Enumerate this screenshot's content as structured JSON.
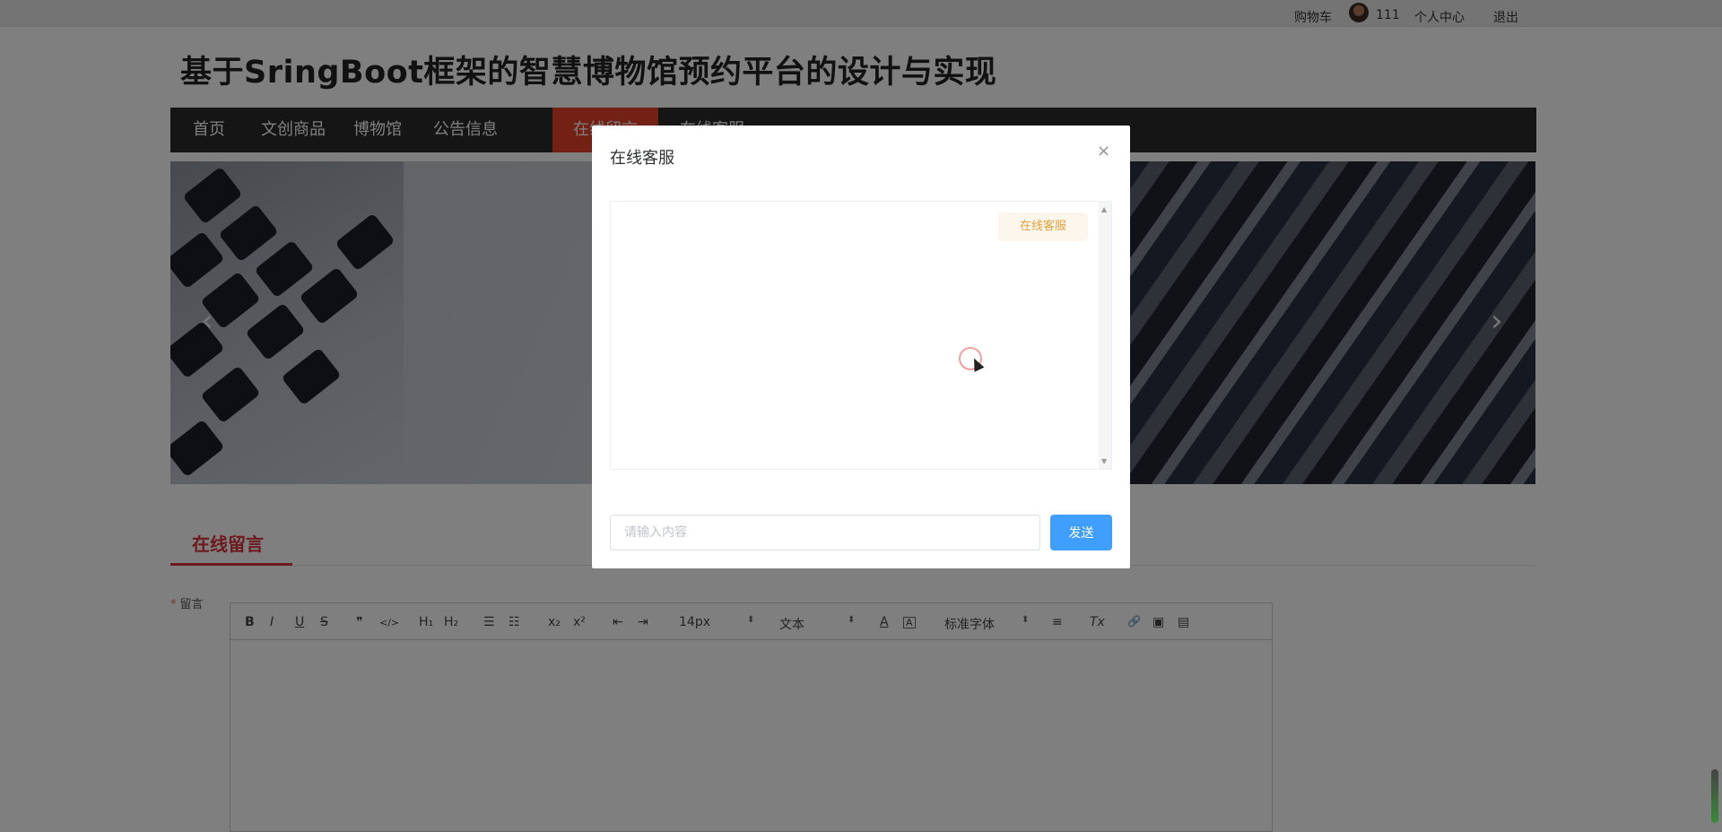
{
  "topbar": {
    "cart": "购物车",
    "username": "111",
    "profile": "个人中心",
    "logout": "退出"
  },
  "site": {
    "title": "基于SringBoot框架的智慧博物馆预约平台的设计与实现"
  },
  "nav": {
    "items": [
      {
        "label": "首页"
      },
      {
        "label": "文创商品"
      },
      {
        "label": "博物馆"
      },
      {
        "label": "公告信息"
      },
      {
        "label": "在线留言"
      },
      {
        "label": "在线客服"
      }
    ],
    "active_index": 4
  },
  "banner": {
    "prev_icon": "chevron-left-icon",
    "next_icon": "chevron-right-icon"
  },
  "message_section": {
    "tab_label": "在线留言",
    "field_label": "留言",
    "required_mark": "*",
    "toolbar": {
      "bold": "B",
      "italic": "I",
      "underline": "U",
      "strike": "S",
      "quote": "❞",
      "code": "</>",
      "h1": "H₁",
      "h2": "H₂",
      "ordered_list": "☰",
      "bullet_list": "☷",
      "subscript": "x₂",
      "superscript": "x²",
      "outdent": "⇤",
      "indent": "⇥",
      "size_value": "14px",
      "header_value": "文本",
      "color": "A",
      "background": "A",
      "font_value": "标准字体",
      "align": "≡",
      "clean": "Tx",
      "link": "🔗",
      "image": "▣",
      "video": "▤"
    }
  },
  "dialog": {
    "title": "在线客服",
    "close": "×",
    "bubble_text": "在线客服",
    "input_placeholder": "请输入内容",
    "send_label": "发送"
  },
  "colors": {
    "nav_bg": "#2b2b2b",
    "nav_active": "#e8422a",
    "accent_red": "#d9323f",
    "primary_blue": "#409eff",
    "bubble_text": "#e6a23c",
    "bubble_bg": "#fdf6ec"
  }
}
